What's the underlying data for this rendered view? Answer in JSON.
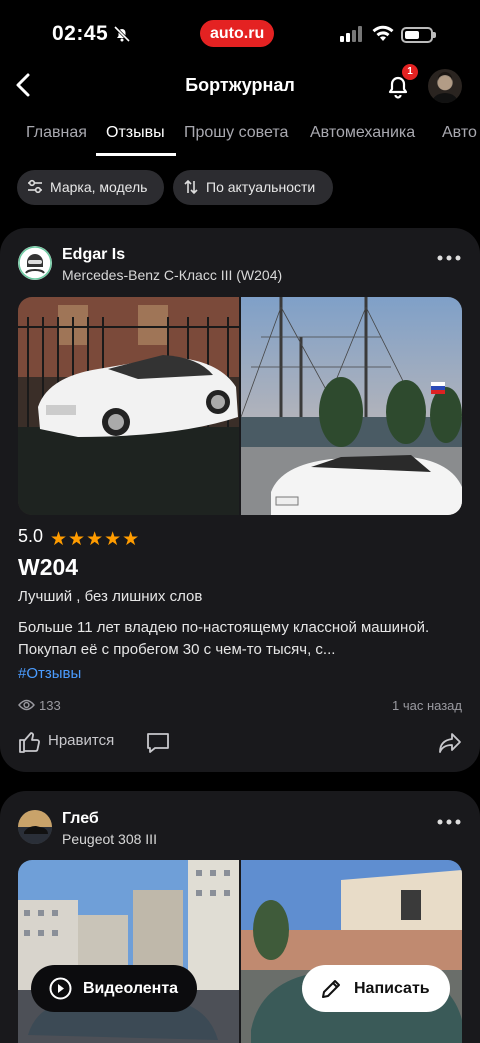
{
  "status_bar": {
    "time": "02:45",
    "brand": "auto.ru"
  },
  "header": {
    "title": "Бортжурнал",
    "notification_count": "1"
  },
  "tabs": [
    {
      "label": "Главная",
      "active": false
    },
    {
      "label": "Отзывы",
      "active": true
    },
    {
      "label": "Прошу совета",
      "active": false
    },
    {
      "label": "Автомеханика",
      "active": false
    },
    {
      "label": "Авто",
      "active": false
    }
  ],
  "filters": {
    "make_model": "Марка, модель",
    "sort": "По актуальности"
  },
  "posts": [
    {
      "author": "Edgar Is",
      "car": "Mercedes-Benz C-Класс III (W204)",
      "rating": "5.0",
      "stars": "★★★★★",
      "title": "W204",
      "subtitle": "Лучший , без лишних слов",
      "body": "Больше 11 лет владею по-настоящему классной машиной. Покупал её с пробегом 30 с чем-то тысяч, с...",
      "tag": "#Отзывы",
      "views": "133",
      "time_ago": "1 час назад",
      "like_label": "Нравится"
    },
    {
      "author": "Глеб",
      "car": "Peugeot 308 III"
    }
  ],
  "floating": {
    "video_label": "Видеолента",
    "write_label": "Написать"
  },
  "colors": {
    "accent_red": "#e42222",
    "star": "#ff9c00",
    "link": "#4b9cff",
    "card_bg": "#19191c"
  }
}
